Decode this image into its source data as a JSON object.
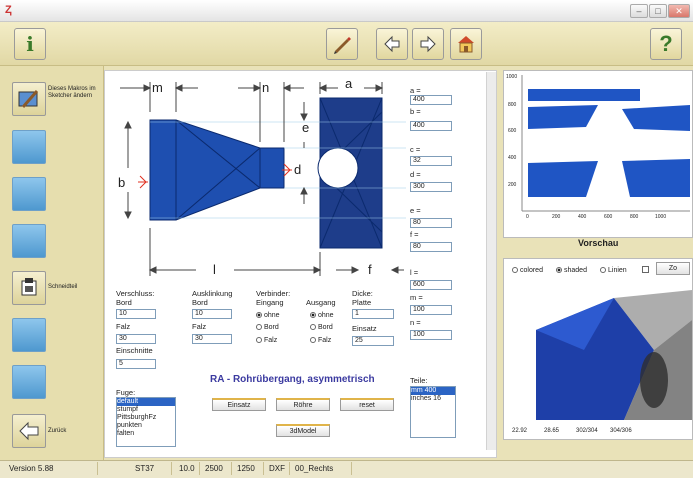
{
  "window": {
    "icon": "Ⱬ",
    "minimize": "–",
    "maximize": "□",
    "close": "✕"
  },
  "toolbar": {
    "info": "ⅰ",
    "help": "?"
  },
  "sidebar": {
    "change_macro": "Dieses Makros im Sketcher ändern",
    "schneidteil": "Schneidteil",
    "back": "Zurück"
  },
  "drawing": {
    "dim_m": "m",
    "dim_n": "n",
    "dim_a": "a",
    "dim_e": "e",
    "dim_b": "b",
    "dim_d": "d",
    "dim_l": "l",
    "dim_f": "f"
  },
  "params": [
    {
      "label": "a =",
      "value": "400"
    },
    {
      "label": "b =",
      "value": "400"
    },
    {
      "label": "c =",
      "value": "32"
    },
    {
      "label": "d =",
      "value": "300"
    },
    {
      "label": "e =",
      "value": "80"
    },
    {
      "label": "f =",
      "value": "80"
    },
    {
      "label": "l =",
      "value": "600"
    },
    {
      "label": "m =",
      "value": "100"
    },
    {
      "label": "n =",
      "value": "100"
    }
  ],
  "form": {
    "verschluss": "Verschluss:",
    "bord": "Bord",
    "bord_val": "10",
    "falz": "Falz",
    "falz_val": "30",
    "einschnitte": "Einschnitte",
    "einschnitte_val": "5",
    "ausklinkung": "Ausklinkung",
    "a_bord": "Bord",
    "a_bord_val": "10",
    "a_falz": "Falz",
    "a_falz_val": "30",
    "verbinder": "Verbinder:",
    "eingang": "Eingang",
    "ausgang": "Ausgang",
    "ohne": "ohne",
    "r_bord": "Bord",
    "r_falz": "Falz",
    "dicke": "Dicke:",
    "platte": "Platte",
    "platte_val": "1",
    "einsatz": "Einsatz",
    "einsatz_val": "25",
    "fuge": "Fuge:",
    "fuge_items": [
      "default",
      "stumpf",
      "PittsburghFz",
      "punkten",
      "falten"
    ],
    "title": "RA - Rohrübergang, asymmetrisch",
    "btn_einsatz": "Einsatz",
    "btn_rohre": "Röhre",
    "btn_reset": "reset",
    "btn_3d": "3dModel",
    "teile": "Teile:",
    "teile_items": [
      "mm 400",
      "inches 16"
    ]
  },
  "preview": {
    "title": "Vorschau",
    "yticks": [
      "1000",
      "800",
      "600",
      "400",
      "200"
    ],
    "xticks": [
      "0",
      "200",
      "400",
      "600",
      "800",
      "1000"
    ],
    "opt_colored": "colored",
    "opt_shaded": "shaded",
    "opt_linien": "Linien",
    "zoom": "Zo",
    "coords": [
      "22.92",
      "28.65",
      "302/304",
      "304/306"
    ]
  },
  "status": {
    "version": "Version 5.88",
    "material": "ST37",
    "f1": "10.0",
    "f2": "2500",
    "f3": "1250",
    "f4": "DXF",
    "f5": "00_Rechts"
  }
}
